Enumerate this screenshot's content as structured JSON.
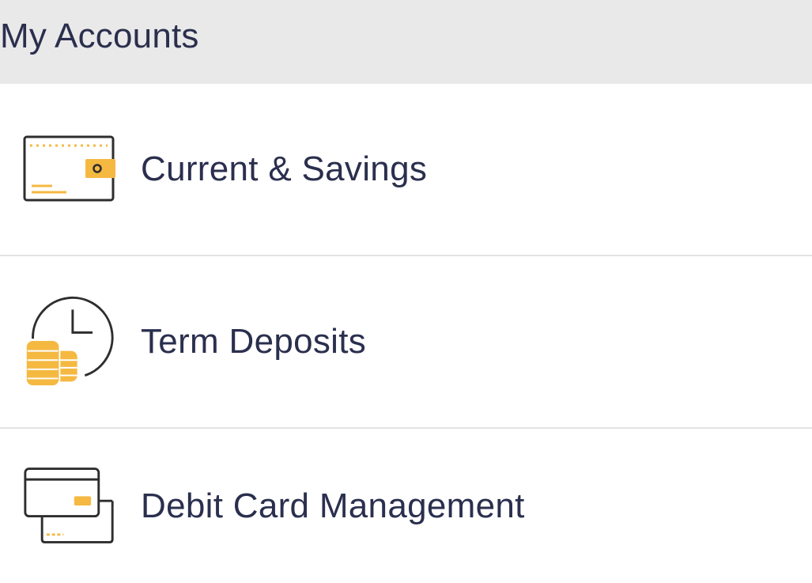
{
  "header": {
    "title": "My Accounts"
  },
  "items": [
    {
      "label": "Current & Savings",
      "icon": "wallet-card-icon"
    },
    {
      "label": "Term Deposits",
      "icon": "clock-coins-icon"
    },
    {
      "label": "Debit Card Management",
      "icon": "cards-icon"
    }
  ],
  "colors": {
    "accent": "#f5b942",
    "text": "#2b2f4e",
    "icon_stroke": "#2e2e2e",
    "header_bg": "#e9e9e9",
    "divider": "#e3e3e3"
  }
}
